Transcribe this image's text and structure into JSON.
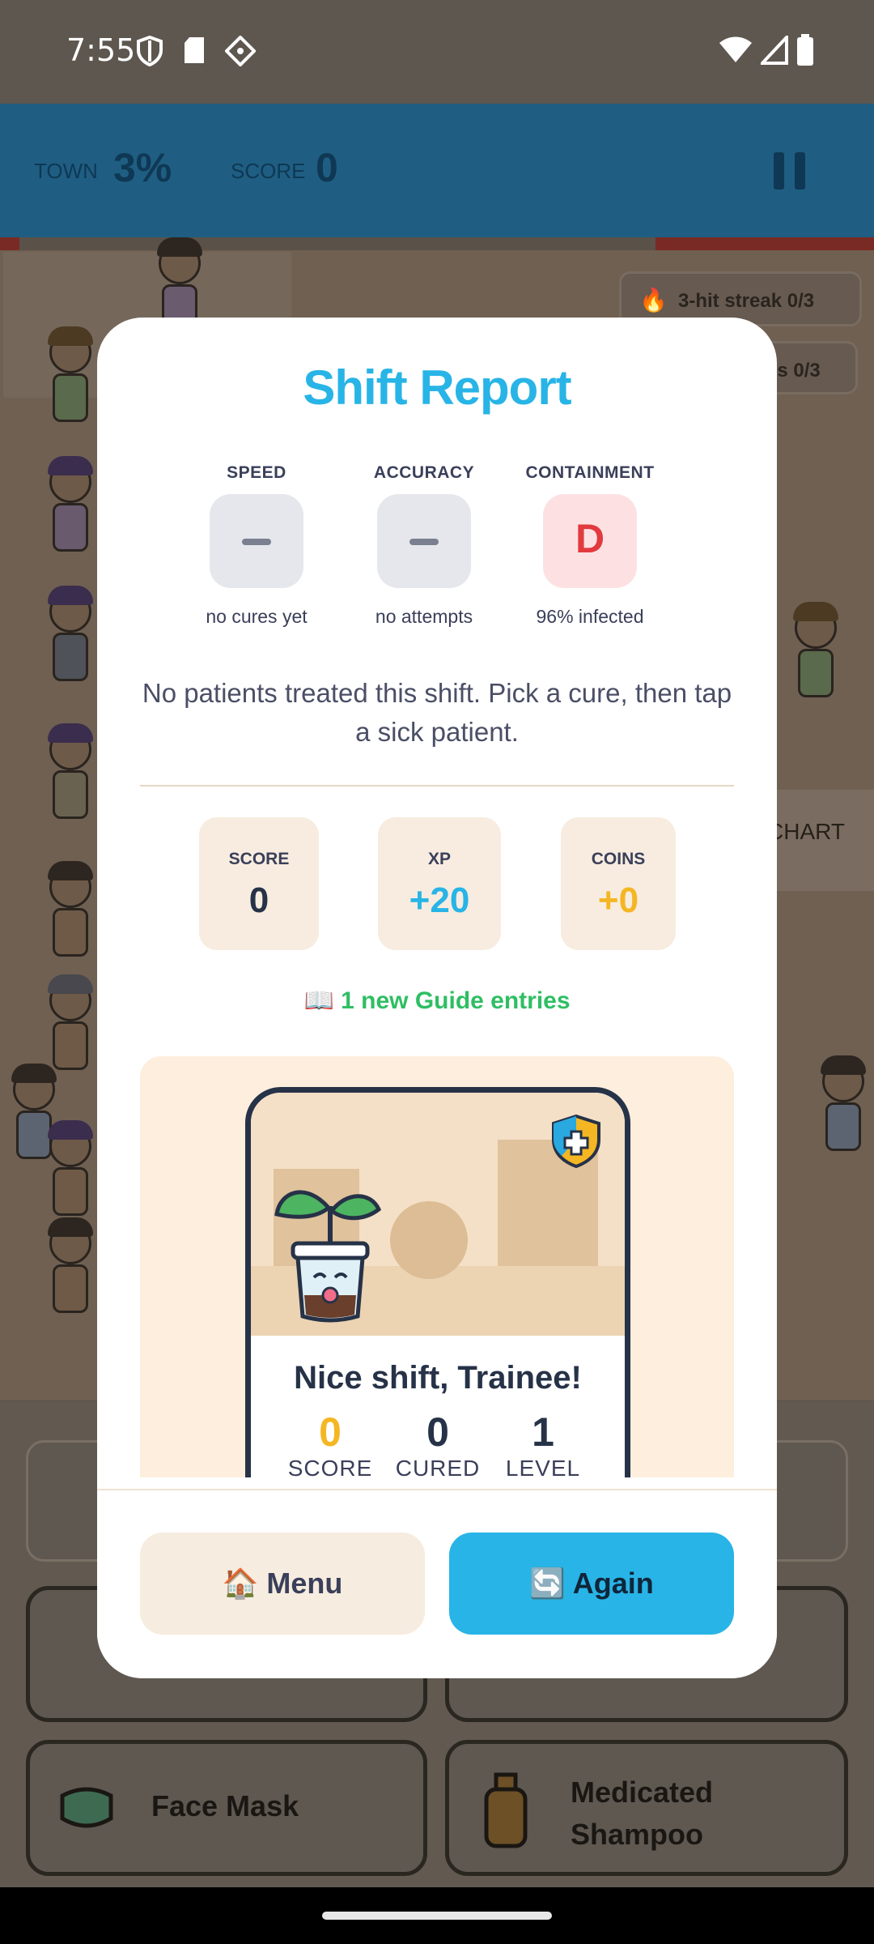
{
  "status_bar": {
    "time": "7:55"
  },
  "hud": {
    "town_label": "TOWN",
    "town_value": "3%",
    "score_label": "SCORE",
    "score_value": "0"
  },
  "background": {
    "streak_pill": "3-hit streak 0/3",
    "second_pill": "es 0/3",
    "chart_tab": "CHART",
    "cures": [
      "Face Mask",
      "Medicated Shampoo"
    ]
  },
  "modal": {
    "title": "Shift Report",
    "grades": [
      {
        "label": "SPEED",
        "value": "",
        "sub": "no cures yet"
      },
      {
        "label": "ACCURACY",
        "value": "",
        "sub": "no attempts"
      },
      {
        "label": "CONTAINMENT",
        "value": "D",
        "sub": "96% infected"
      }
    ],
    "message": "No patients treated this shift. Pick a cure, then tap a sick patient.",
    "stats": [
      {
        "label": "SCORE",
        "value": "0"
      },
      {
        "label": "XP",
        "value": "+20"
      },
      {
        "label": "COINS",
        "value": "+0"
      }
    ],
    "guide": "📖 1 new Guide entries",
    "share_card": {
      "headline": "Nice shift, Trainee!",
      "stats": [
        {
          "value": "0",
          "label": "SCORE"
        },
        {
          "value": "0",
          "label": "CURED"
        },
        {
          "value": "1",
          "label": "LEVEL"
        }
      ]
    },
    "buttons": {
      "menu": "🏠 Menu",
      "again": "🔄 Again"
    }
  },
  "colors": {
    "accent": "#28b4e6",
    "grade_bad": "#e23a3e",
    "xp": "#28b4e6",
    "coins": "#f5b623",
    "guide": "#2fbe63"
  },
  "icons": [
    "shield-icon",
    "sd-card-icon",
    "wifi-icon",
    "signal-icon",
    "battery-icon",
    "pause-icon",
    "fire-icon",
    "plant-mascot-icon",
    "badge-shield-icon"
  ]
}
